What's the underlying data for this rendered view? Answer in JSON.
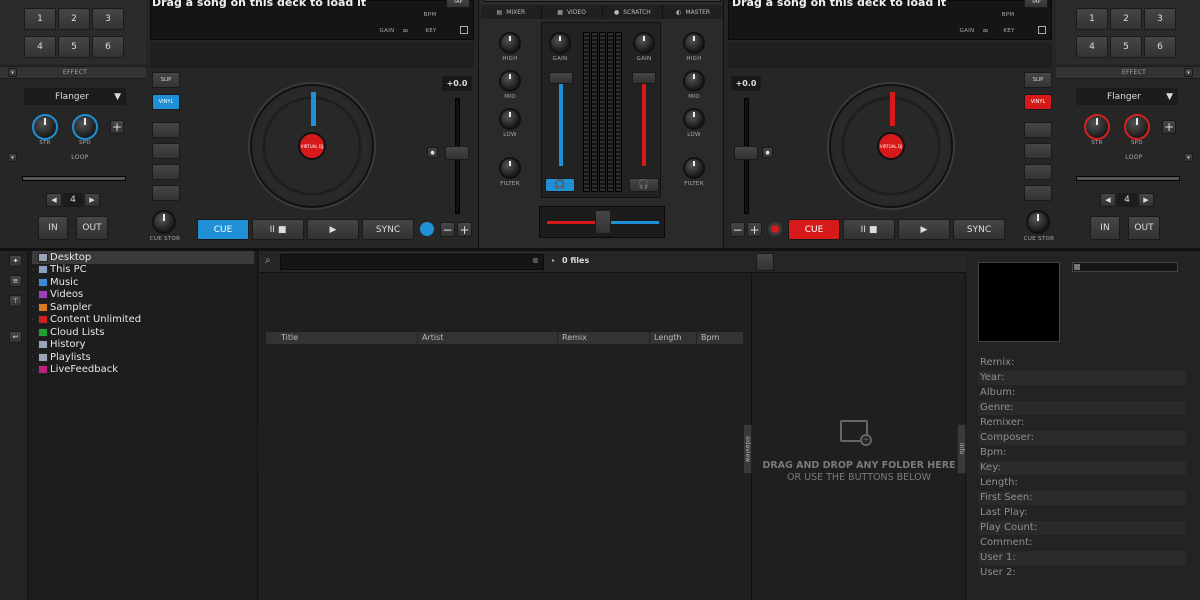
{
  "deck_left": {
    "track_prompt": "Drag a song on this deck to load it",
    "tap": "TAP",
    "bpm": "BPM",
    "gain": "GAIN",
    "key": "KEY",
    "pad_buttons": [
      "1",
      "2",
      "3",
      "4",
      "5",
      "6"
    ],
    "effect_label": "EFFECT",
    "effect_name": "Flanger",
    "knob_1": "STR",
    "knob_2": "SPD",
    "loop_label": "LOOP",
    "loop_value": "4",
    "in": "IN",
    "out": "OUT",
    "cue_label": "CUE STOR",
    "slip": "SLIP",
    "vinyl": "VINYL",
    "pitch": "+0.0",
    "jog_brand": "VIRTUAL DJ",
    "cue": "CUE",
    "play_pause": "II ■",
    "play": "▶",
    "sync": "SYNC"
  },
  "deck_right": {
    "track_prompt": "Drag a song on this deck to load it",
    "tap": "TAP",
    "bpm": "BPM",
    "gain": "GAIN",
    "key": "KEY",
    "pad_buttons": [
      "1",
      "2",
      "3",
      "4",
      "5",
      "6"
    ],
    "effect_label": "EFFECT",
    "effect_name": "Flanger",
    "knob_1": "STR",
    "knob_2": "SPD",
    "loop_label": "LOOP",
    "loop_value": "4",
    "in": "IN",
    "out": "OUT",
    "cue_label": "CUE STOR",
    "slip": "SLIP",
    "vinyl": "VINYL",
    "pitch": "+0.0",
    "jog_brand": "VIRTUAL DJ",
    "cue": "CUE",
    "play_pause": "II ■",
    "play": "▶",
    "sync": "SYNC"
  },
  "mixer": {
    "tabs": [
      "MIXER",
      "VIDEO",
      "SCRATCH",
      "MASTER"
    ],
    "left_eq": [
      "HIGH",
      "MID",
      "LOW",
      "FILTER"
    ],
    "right_eq": [
      "HIGH",
      "MID",
      "LOW",
      "FILTER"
    ],
    "gain": "GAIN"
  },
  "browser": {
    "folders": [
      {
        "label": "Desktop",
        "color": "#9aa4b4"
      },
      {
        "label": "This PC",
        "color": "#8aa0c0"
      },
      {
        "label": "Music",
        "color": "#3a8ad8"
      },
      {
        "label": "Videos",
        "color": "#a040c0"
      },
      {
        "label": "Sampler",
        "color": "#d87a20"
      },
      {
        "label": "Content Unlimited",
        "color": "#d02020"
      },
      {
        "label": "Cloud Lists",
        "color": "#20a030"
      },
      {
        "label": "History",
        "color": "#9aa4b4"
      },
      {
        "label": "Playlists",
        "color": "#9aa4b4"
      },
      {
        "label": "LiveFeedback",
        "color": "#c02080"
      }
    ],
    "search_placeholder": "",
    "file_count": "0 files",
    "columns": [
      "Title",
      "Artist",
      "Remix",
      "Length",
      "Bpm"
    ],
    "sidetab_folders": "folders",
    "sidetab_sideview": "sideview",
    "sidetab_info": "info",
    "drop_line_1": "DRAG AND DROP ANY FOLDER HERE",
    "drop_line_2": "OR USE THE BUTTONS BELOW"
  },
  "info": {
    "fields": [
      "Remix:",
      "Year:",
      "Album:",
      "Genre:",
      "Remixer:",
      "Composer:",
      "Bpm:",
      "Key:",
      "Length:",
      "First Seen:",
      "Last Play:",
      "Play Count:",
      "Comment:",
      "User 1:",
      "User 2:"
    ]
  },
  "colors": {
    "accent_blue": "#1f8fd6",
    "accent_red": "#d61a1a"
  }
}
